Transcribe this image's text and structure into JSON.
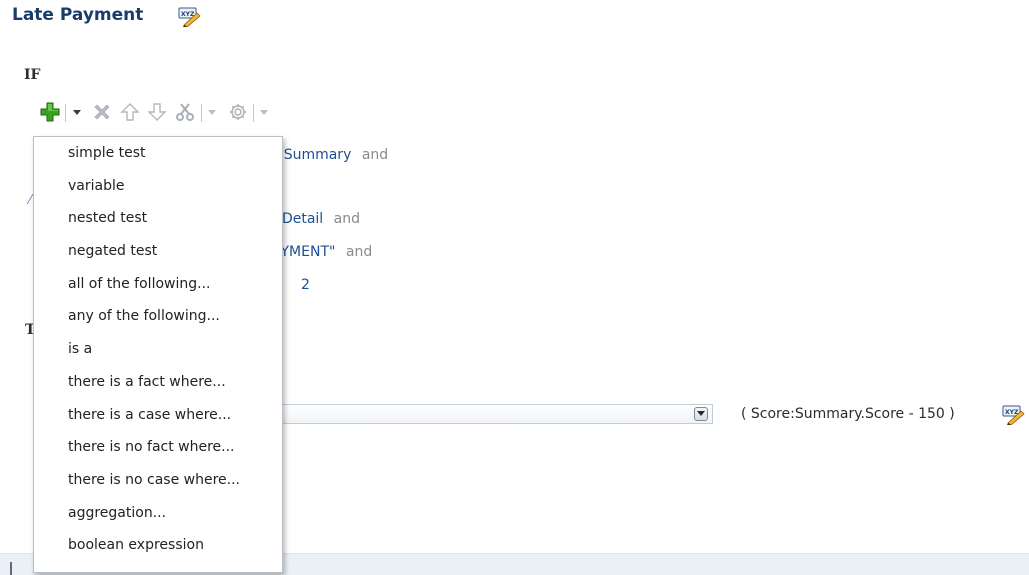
{
  "page": {
    "title": "Late Payment",
    "title_icon": "xyz-pencil-icon"
  },
  "if_section": {
    "label": "IF",
    "toolbar": {
      "add_icon": "plus-icon",
      "add_menu_icon": "chevron-down-icon",
      "delete_icon": "delete-x-icon",
      "move_up_icon": "arrow-up-icon",
      "move_down_icon": "arrow-down-icon",
      "cut_icon": "scissors-icon",
      "cut_menu_icon": "chevron-down-icon",
      "settings_icon": "gear-icon",
      "settings_menu_icon": "chevron-down-icon"
    },
    "visible_rule_fragments": [
      {
        "text": "rt Summary",
        "joiner": "and"
      },
      {
        "text": "t Detail",
        "joiner": "and"
      },
      {
        "text": "AYMENT\"",
        "joiner": "and"
      },
      {
        "text": "2",
        "joiner": ""
      }
    ]
  },
  "then_section": {
    "fragment": "T",
    "select_button_icon": "chevron-down-icon",
    "expression": "( Score:Summary.Score - 150 )",
    "expression_icon": "xyz-pencil-icon"
  },
  "add_menu": {
    "items": [
      "simple test",
      "variable",
      "nested test",
      "negated test",
      "all of the following...",
      "any of the following...",
      "is a",
      "there is a fact where...",
      "there is a case where...",
      "there is no fact where...",
      "there is no case where...",
      "aggregation...",
      "boolean expression"
    ]
  },
  "colors": {
    "title": "#1b3c6a",
    "link_blue": "#1f4e96",
    "joiner_gray": "#8a8a8a",
    "add_green": "#3aa31e"
  }
}
